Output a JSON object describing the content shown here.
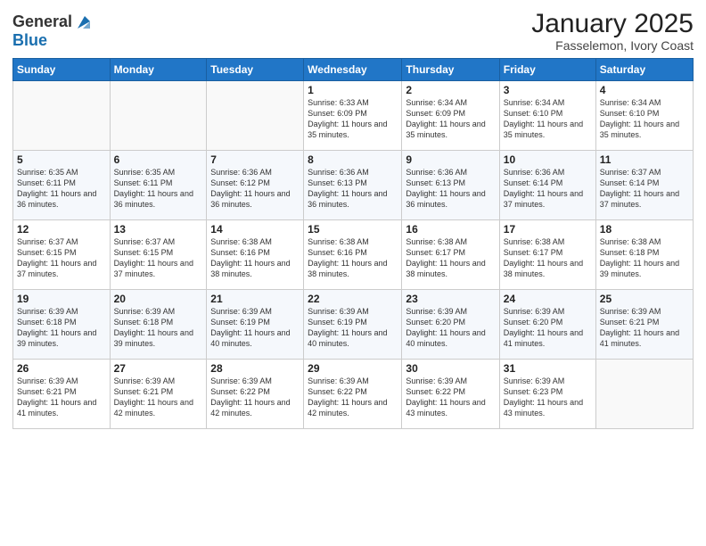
{
  "header": {
    "logo_general": "General",
    "logo_blue": "Blue",
    "month_title": "January 2025",
    "location": "Fasselemon, Ivory Coast"
  },
  "days_of_week": [
    "Sunday",
    "Monday",
    "Tuesday",
    "Wednesday",
    "Thursday",
    "Friday",
    "Saturday"
  ],
  "weeks": [
    [
      {
        "day": "",
        "info": ""
      },
      {
        "day": "",
        "info": ""
      },
      {
        "day": "",
        "info": ""
      },
      {
        "day": "1",
        "info": "Sunrise: 6:33 AM\nSunset: 6:09 PM\nDaylight: 11 hours and 35 minutes."
      },
      {
        "day": "2",
        "info": "Sunrise: 6:34 AM\nSunset: 6:09 PM\nDaylight: 11 hours and 35 minutes."
      },
      {
        "day": "3",
        "info": "Sunrise: 6:34 AM\nSunset: 6:10 PM\nDaylight: 11 hours and 35 minutes."
      },
      {
        "day": "4",
        "info": "Sunrise: 6:34 AM\nSunset: 6:10 PM\nDaylight: 11 hours and 35 minutes."
      }
    ],
    [
      {
        "day": "5",
        "info": "Sunrise: 6:35 AM\nSunset: 6:11 PM\nDaylight: 11 hours and 36 minutes."
      },
      {
        "day": "6",
        "info": "Sunrise: 6:35 AM\nSunset: 6:11 PM\nDaylight: 11 hours and 36 minutes."
      },
      {
        "day": "7",
        "info": "Sunrise: 6:36 AM\nSunset: 6:12 PM\nDaylight: 11 hours and 36 minutes."
      },
      {
        "day": "8",
        "info": "Sunrise: 6:36 AM\nSunset: 6:13 PM\nDaylight: 11 hours and 36 minutes."
      },
      {
        "day": "9",
        "info": "Sunrise: 6:36 AM\nSunset: 6:13 PM\nDaylight: 11 hours and 36 minutes."
      },
      {
        "day": "10",
        "info": "Sunrise: 6:36 AM\nSunset: 6:14 PM\nDaylight: 11 hours and 37 minutes."
      },
      {
        "day": "11",
        "info": "Sunrise: 6:37 AM\nSunset: 6:14 PM\nDaylight: 11 hours and 37 minutes."
      }
    ],
    [
      {
        "day": "12",
        "info": "Sunrise: 6:37 AM\nSunset: 6:15 PM\nDaylight: 11 hours and 37 minutes."
      },
      {
        "day": "13",
        "info": "Sunrise: 6:37 AM\nSunset: 6:15 PM\nDaylight: 11 hours and 37 minutes."
      },
      {
        "day": "14",
        "info": "Sunrise: 6:38 AM\nSunset: 6:16 PM\nDaylight: 11 hours and 38 minutes."
      },
      {
        "day": "15",
        "info": "Sunrise: 6:38 AM\nSunset: 6:16 PM\nDaylight: 11 hours and 38 minutes."
      },
      {
        "day": "16",
        "info": "Sunrise: 6:38 AM\nSunset: 6:17 PM\nDaylight: 11 hours and 38 minutes."
      },
      {
        "day": "17",
        "info": "Sunrise: 6:38 AM\nSunset: 6:17 PM\nDaylight: 11 hours and 38 minutes."
      },
      {
        "day": "18",
        "info": "Sunrise: 6:38 AM\nSunset: 6:18 PM\nDaylight: 11 hours and 39 minutes."
      }
    ],
    [
      {
        "day": "19",
        "info": "Sunrise: 6:39 AM\nSunset: 6:18 PM\nDaylight: 11 hours and 39 minutes."
      },
      {
        "day": "20",
        "info": "Sunrise: 6:39 AM\nSunset: 6:18 PM\nDaylight: 11 hours and 39 minutes."
      },
      {
        "day": "21",
        "info": "Sunrise: 6:39 AM\nSunset: 6:19 PM\nDaylight: 11 hours and 40 minutes."
      },
      {
        "day": "22",
        "info": "Sunrise: 6:39 AM\nSunset: 6:19 PM\nDaylight: 11 hours and 40 minutes."
      },
      {
        "day": "23",
        "info": "Sunrise: 6:39 AM\nSunset: 6:20 PM\nDaylight: 11 hours and 40 minutes."
      },
      {
        "day": "24",
        "info": "Sunrise: 6:39 AM\nSunset: 6:20 PM\nDaylight: 11 hours and 41 minutes."
      },
      {
        "day": "25",
        "info": "Sunrise: 6:39 AM\nSunset: 6:21 PM\nDaylight: 11 hours and 41 minutes."
      }
    ],
    [
      {
        "day": "26",
        "info": "Sunrise: 6:39 AM\nSunset: 6:21 PM\nDaylight: 11 hours and 41 minutes."
      },
      {
        "day": "27",
        "info": "Sunrise: 6:39 AM\nSunset: 6:21 PM\nDaylight: 11 hours and 42 minutes."
      },
      {
        "day": "28",
        "info": "Sunrise: 6:39 AM\nSunset: 6:22 PM\nDaylight: 11 hours and 42 minutes."
      },
      {
        "day": "29",
        "info": "Sunrise: 6:39 AM\nSunset: 6:22 PM\nDaylight: 11 hours and 42 minutes."
      },
      {
        "day": "30",
        "info": "Sunrise: 6:39 AM\nSunset: 6:22 PM\nDaylight: 11 hours and 43 minutes."
      },
      {
        "day": "31",
        "info": "Sunrise: 6:39 AM\nSunset: 6:23 PM\nDaylight: 11 hours and 43 minutes."
      },
      {
        "day": "",
        "info": ""
      }
    ]
  ]
}
